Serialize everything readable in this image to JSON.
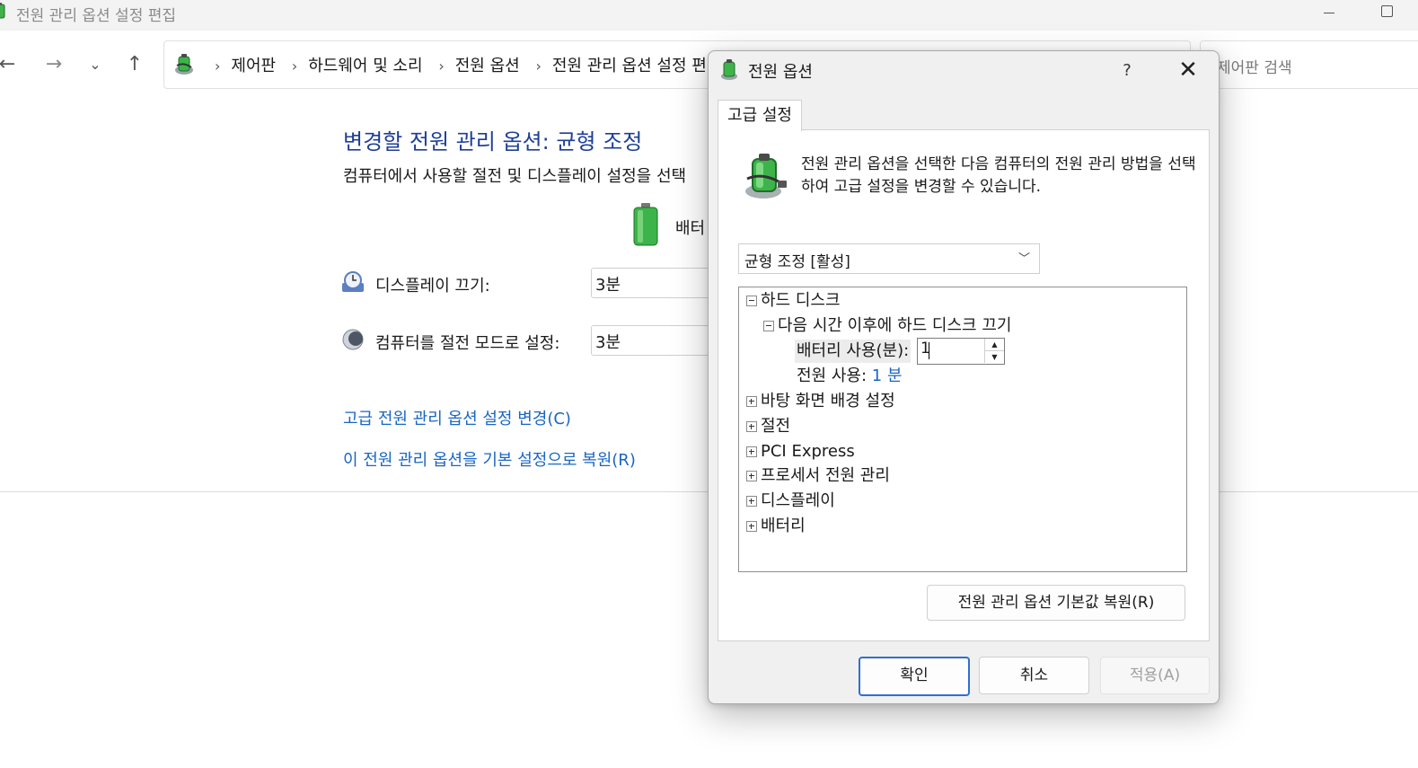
{
  "window": {
    "title": "전원 관리 옵션 설정 편집",
    "breadcrumbs": [
      "제어판",
      "하드웨어 및 소리",
      "전원 옵션",
      "전원 관리 옵션 설정 편"
    ],
    "search_placeholder": "제어판 검색"
  },
  "main": {
    "heading": "변경할 전원 관리 옵션: 균형 조정",
    "description": "컴퓨터에서 사용할 절전 및 디스플레이 설정을 선택",
    "battery_column_label": "배터",
    "rows": [
      {
        "label": "디스플레이 끄기:",
        "value": "3분"
      },
      {
        "label": "컴퓨터를 절전 모드로 설정:",
        "value": "3분"
      }
    ],
    "links": {
      "advanced": "고급 전원 관리 옵션 설정 변경(C)",
      "restore_plan": "이 전원 관리 옵션을 기본 설정으로 복원(R)"
    }
  },
  "dialog": {
    "title": "전원 옵션",
    "help": "?",
    "close": "✕",
    "tab": "고급 설정",
    "description": "전원 관리 옵션을 선택한 다음 컴퓨터의 전원 관리 방법을 선택하여 고급 설정을 변경할 수 있습니다.",
    "plan_select": "균형 조정 [활성]",
    "tree": {
      "hard_disk": "하드 디스크",
      "turn_off_after": "다음 시간 이후에 하드 디스크 끄기",
      "on_battery_label": "배터리 사용(분):",
      "on_battery_value": "1",
      "plugged_in_label": "전원 사용:",
      "plugged_in_value": "1 분",
      "collapsed": [
        "바탕 화면 배경 설정",
        "절전",
        "PCI Express",
        "프로세서 전원 관리",
        "디스플레이",
        "배터리"
      ]
    },
    "restore_defaults": "전원 관리 옵션 기본값 복원(R)",
    "buttons": {
      "ok": "확인",
      "cancel": "취소",
      "apply": "적용(A)"
    }
  },
  "colors": {
    "heading": "#1e3f95",
    "link": "#1a66c2",
    "accent_border": "#2f6fcf",
    "battery_green": "#3cb44a"
  },
  "icons": [
    "power-options-icon",
    "back-arrow-icon",
    "forward-arrow-icon",
    "chevron-down-icon",
    "up-arrow-icon",
    "battery-icon",
    "clock-icon",
    "moon-icon"
  ]
}
